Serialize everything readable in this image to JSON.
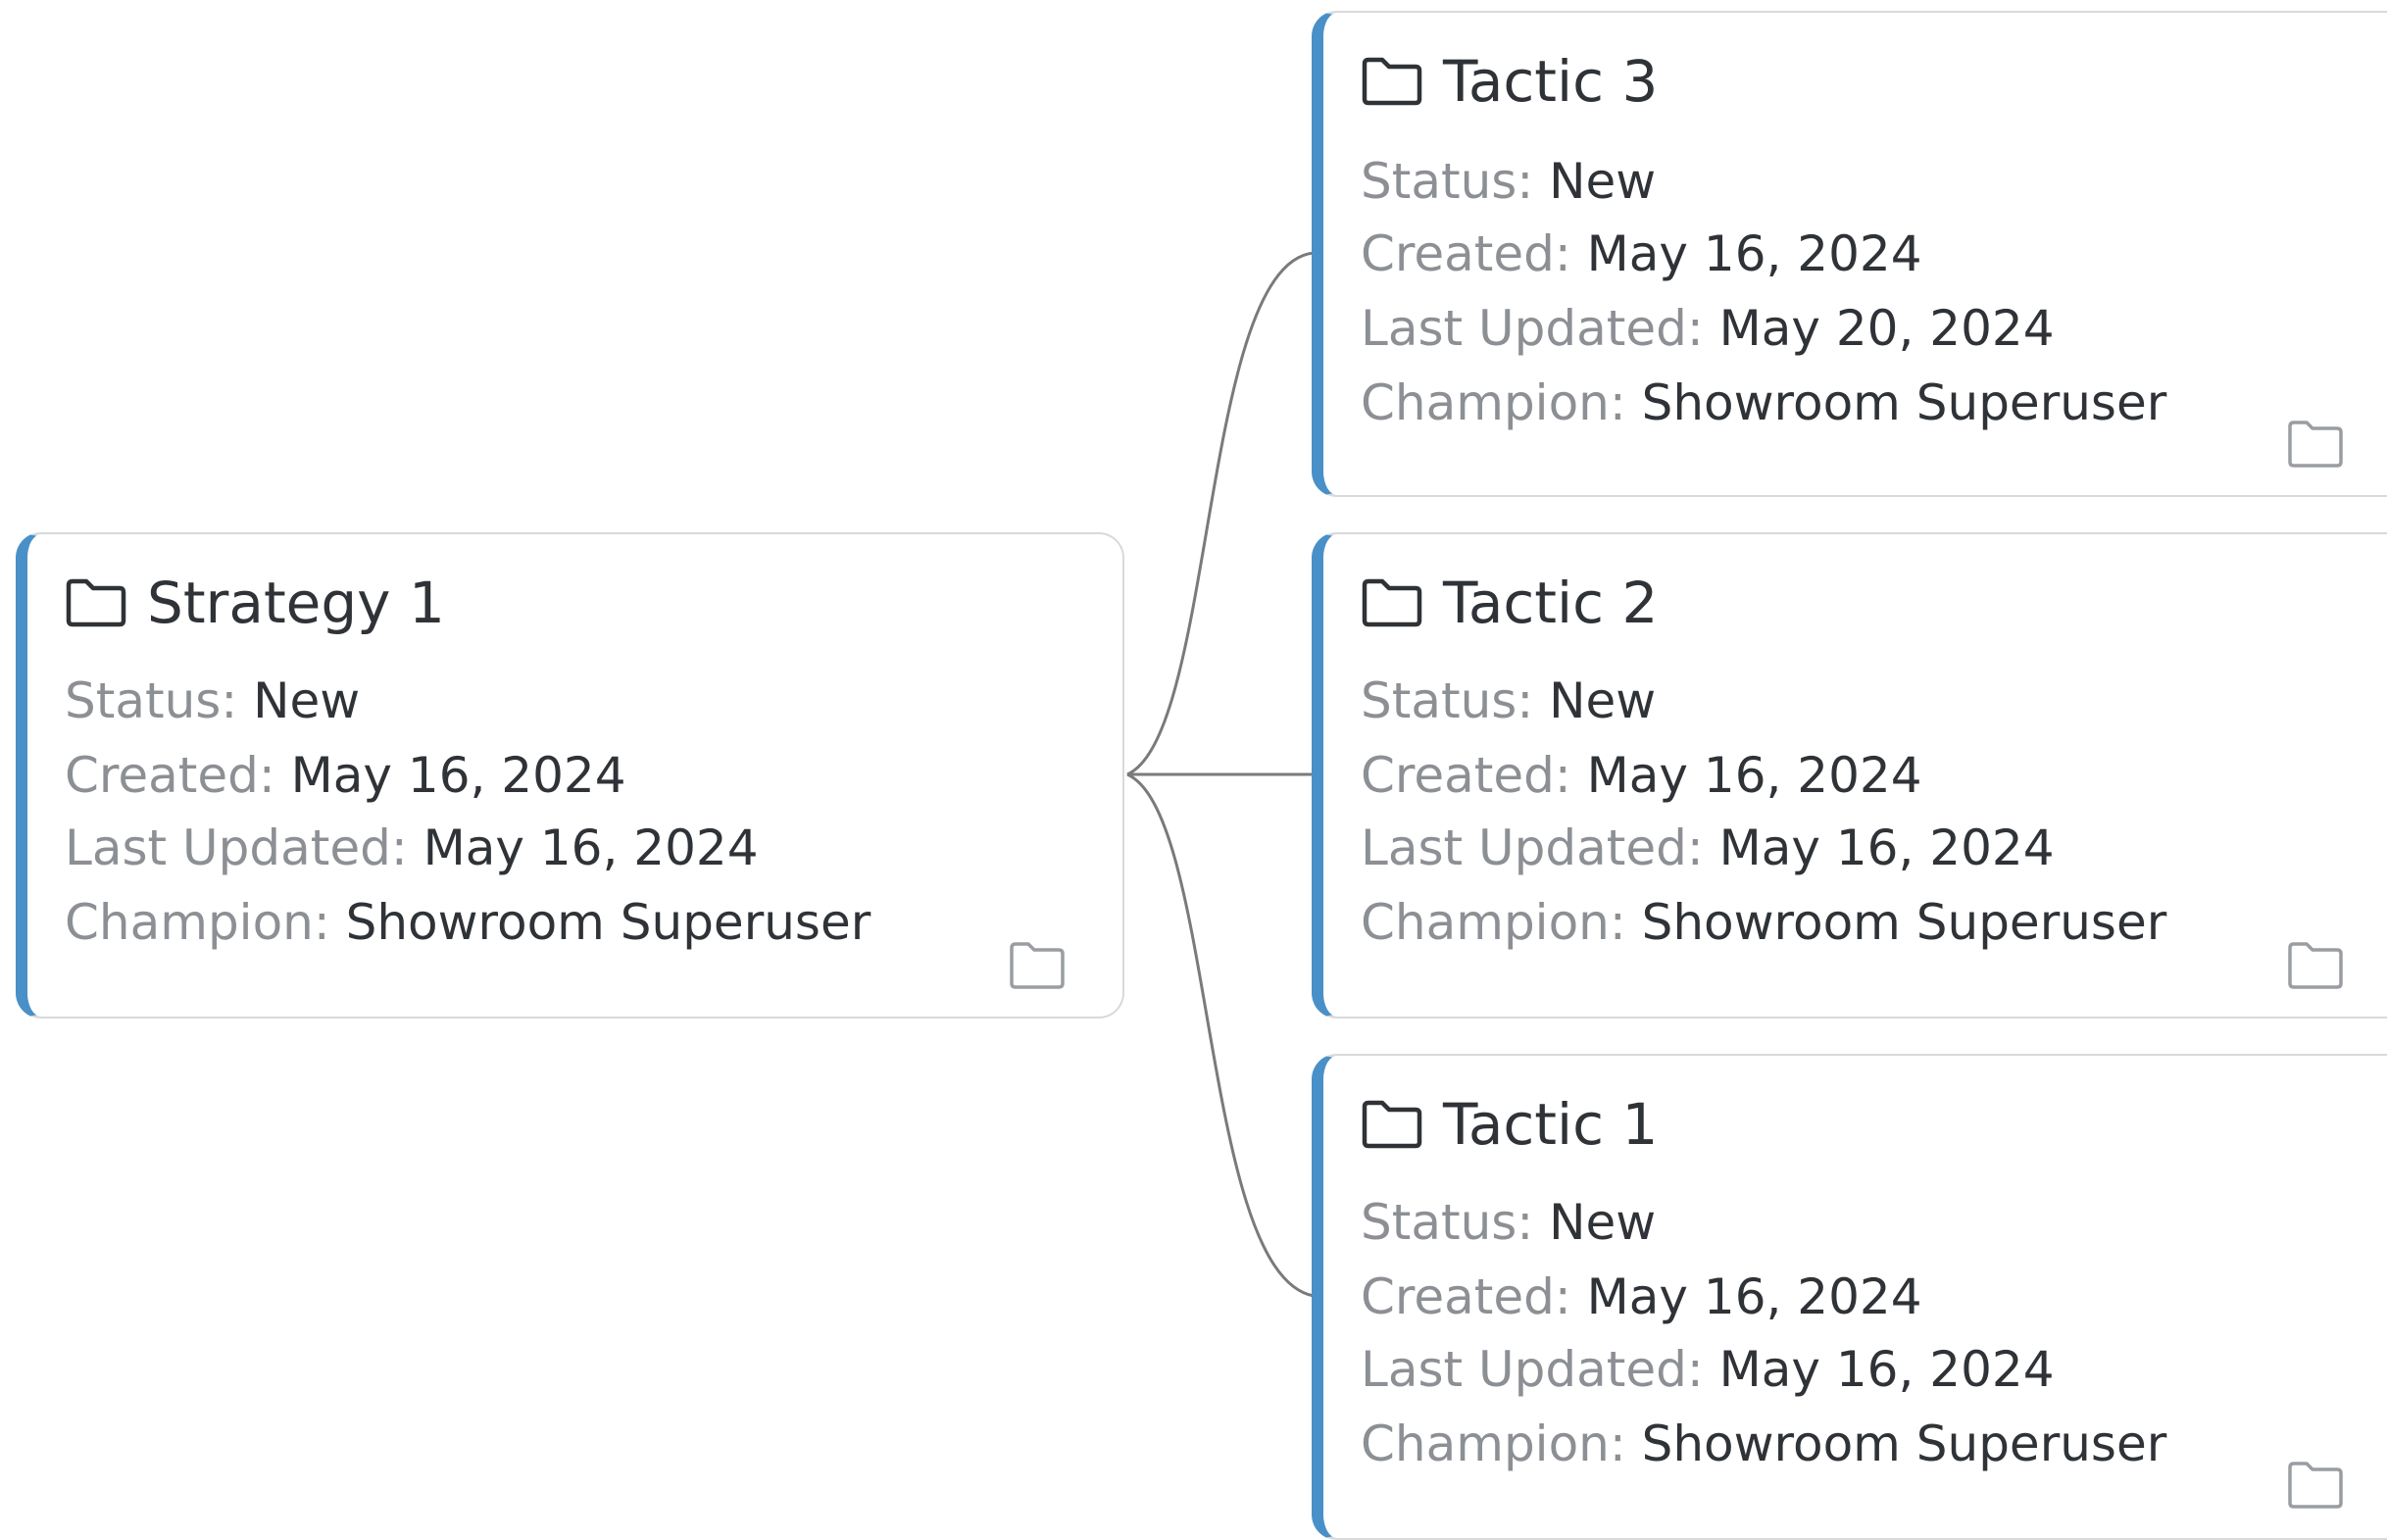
{
  "colors": {
    "accent_stripe": "#4a90c8",
    "card_border": "#d9d9d9",
    "connector": "#7a7a7a",
    "label_text": "#8c8f94",
    "value_text": "#2f3337"
  },
  "icons": {
    "title": "folder-icon",
    "footer": "folder-icon"
  },
  "strategy": {
    "title": "Strategy 1",
    "fields": [
      {
        "label": "Status: ",
        "value": "New"
      },
      {
        "label": "Created: ",
        "value": "May 16, 2024"
      },
      {
        "label": "Last Updated: ",
        "value": "May 16, 2024"
      },
      {
        "label": "Champion: ",
        "value": "Showroom Superuser"
      }
    ]
  },
  "tactics": [
    {
      "title": "Tactic 3",
      "fields": [
        {
          "label": "Status: ",
          "value": "New"
        },
        {
          "label": "Created: ",
          "value": "May 16, 2024"
        },
        {
          "label": "Last Updated: ",
          "value": "May 20, 2024"
        },
        {
          "label": "Champion: ",
          "value": "Showroom Superuser"
        }
      ]
    },
    {
      "title": "Tactic 2",
      "fields": [
        {
          "label": "Status: ",
          "value": "New"
        },
        {
          "label": "Created: ",
          "value": "May 16, 2024"
        },
        {
          "label": "Last Updated: ",
          "value": "May 16, 2024"
        },
        {
          "label": "Champion: ",
          "value": "Showroom Superuser"
        }
      ]
    },
    {
      "title": "Tactic 1",
      "fields": [
        {
          "label": "Status: ",
          "value": "New"
        },
        {
          "label": "Created: ",
          "value": "May 16, 2024"
        },
        {
          "label": "Last Updated: ",
          "value": "May 16, 2024"
        },
        {
          "label": "Champion: ",
          "value": "Showroom Superuser"
        }
      ]
    }
  ]
}
